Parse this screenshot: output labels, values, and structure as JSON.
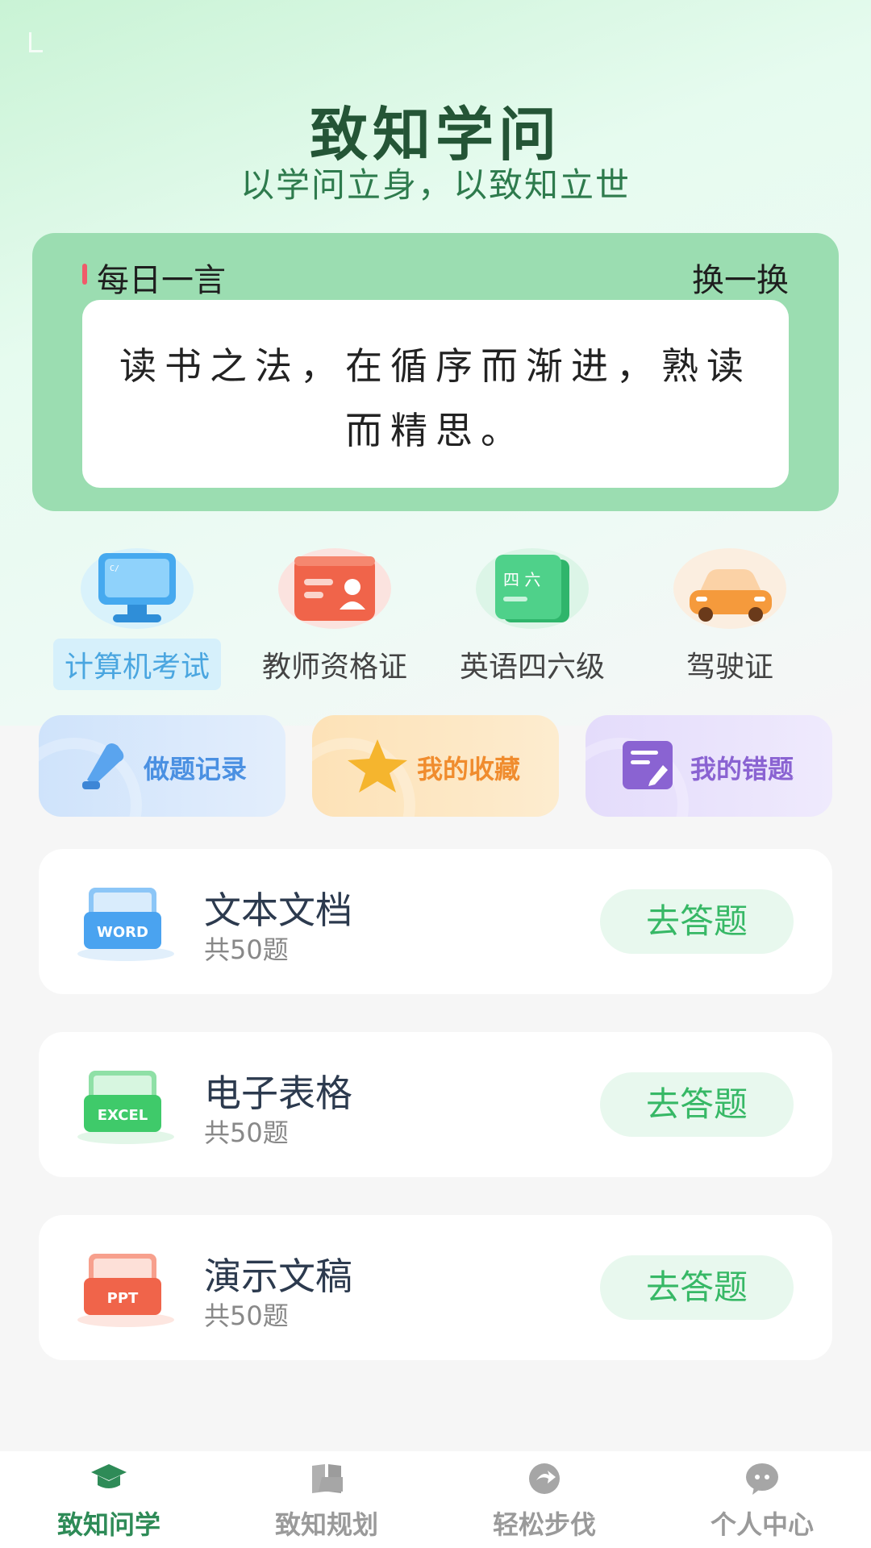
{
  "header": {
    "title": "致知学问",
    "slogan": "以学问立身，以致知立世"
  },
  "daily_quote": {
    "label": "每日一言",
    "refresh_label": "换一换",
    "text": "读书之法，在循序而渐进，熟读而精思。"
  },
  "categories": [
    {
      "label": "计算机考试",
      "icon": "monitor-icon",
      "active": true
    },
    {
      "label": "教师资格证",
      "icon": "id-card-icon",
      "active": false
    },
    {
      "label": "英语四六级",
      "icon": "book-icon",
      "active": false
    },
    {
      "label": "驾驶证",
      "icon": "car-icon",
      "active": false
    }
  ],
  "quick_actions": [
    {
      "label": "做题记录",
      "icon": "pen-icon",
      "color": "#4a90e2"
    },
    {
      "label": "我的收藏",
      "icon": "star-icon",
      "color": "#f08c2e"
    },
    {
      "label": "我的错题",
      "icon": "note-edit-icon",
      "color": "#8a63d2"
    }
  ],
  "courses": [
    {
      "title": "文本文档",
      "count": "共50题",
      "button": "去答题",
      "badge": "WORD",
      "color": "#4aa3f0"
    },
    {
      "title": "电子表格",
      "count": "共50题",
      "button": "去答题",
      "badge": "EXCEL",
      "color": "#3fca6a"
    },
    {
      "title": "演示文稿",
      "count": "共50题",
      "button": "去答题",
      "badge": "PPT",
      "color": "#f0644a"
    }
  ],
  "tabbar": [
    {
      "label": "致知问学",
      "icon": "graduation-cap-icon",
      "active": true
    },
    {
      "label": "致知规划",
      "icon": "book-open-icon",
      "active": false
    },
    {
      "label": "轻松步伐",
      "icon": "arrow-circle-icon",
      "active": false
    },
    {
      "label": "个人中心",
      "icon": "chat-face-icon",
      "active": false
    }
  ],
  "colors": {
    "accent": "#2e8b57",
    "quote_card": "#9bddb1",
    "button_bg": "#e8f8ee",
    "button_text": "#37b866"
  }
}
